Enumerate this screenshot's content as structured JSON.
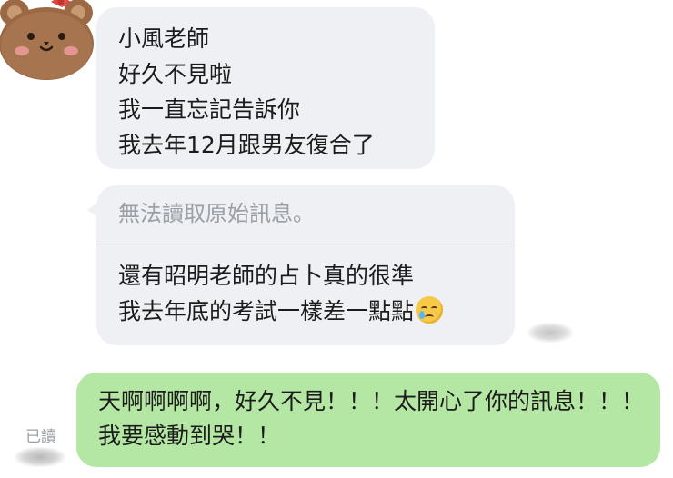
{
  "contact": {
    "avatar_icon": "bear-with-bow-icon"
  },
  "messages": {
    "incoming_1": {
      "lines": [
        "小風老師",
        "好久不見啦",
        "我一直忘記告訴你",
        "我去年12月跟男友復合了"
      ]
    },
    "incoming_2": {
      "quoted": "無法讀取原始訊息。",
      "lines": [
        "還有昭明老師的占卜真的很準",
        "我去年底的考試一樣差一點點"
      ],
      "emoji": "crying-face-emoji-icon"
    },
    "outgoing_1": {
      "text": "天啊啊啊啊，好久不見！！！太開心了你的訊息！！！我要感動到哭！！",
      "read_status": "已讀"
    }
  },
  "colors": {
    "incoming_bubble": "#eef0f3",
    "outgoing_bubble": "#b5e7a4",
    "meta_text": "#9aa0a6"
  }
}
